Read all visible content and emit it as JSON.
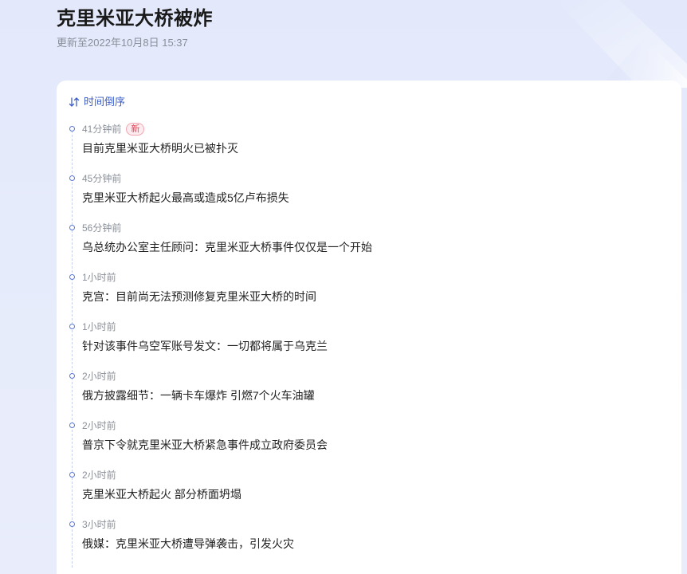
{
  "page": {
    "title": "克里米亚大桥被炸",
    "updated": "更新至2022年10月8日 15:37"
  },
  "sort": {
    "label": "时间倒序",
    "icon": "sort-arrows-icon"
  },
  "timeline": {
    "items": [
      {
        "time": "41分钟前",
        "badge": "新",
        "text": "目前克里米亚大桥明火已被扑灭"
      },
      {
        "time": "45分钟前",
        "text": "克里米亚大桥起火最高或造成5亿卢布损失"
      },
      {
        "time": "56分钟前",
        "text": "乌总统办公室主任顾问：克里米亚大桥事件仅仅是一个开始"
      },
      {
        "time": "1小时前",
        "text": "克宫：目前尚无法预测修复克里米亚大桥的时间"
      },
      {
        "time": "1小时前",
        "text": "针对该事件乌空军账号发文：一切都将属于乌克兰"
      },
      {
        "time": "2小时前",
        "text": "俄方披露细节：一辆卡车爆炸 引燃7个火车油罐"
      },
      {
        "time": "2小时前",
        "text": "普京下令就克里米亚大桥紧急事件成立政府委员会"
      },
      {
        "time": "2小时前",
        "text": "克里米亚大桥起火 部分桥面坍塌"
      },
      {
        "time": "3小时前",
        "text": "俄媒：克里米亚大桥遭导弹袭击，引发火灾"
      }
    ]
  },
  "colors": {
    "accent": "#3d5ec9",
    "badge": "#e0475b",
    "background": "#e3e9fb"
  }
}
